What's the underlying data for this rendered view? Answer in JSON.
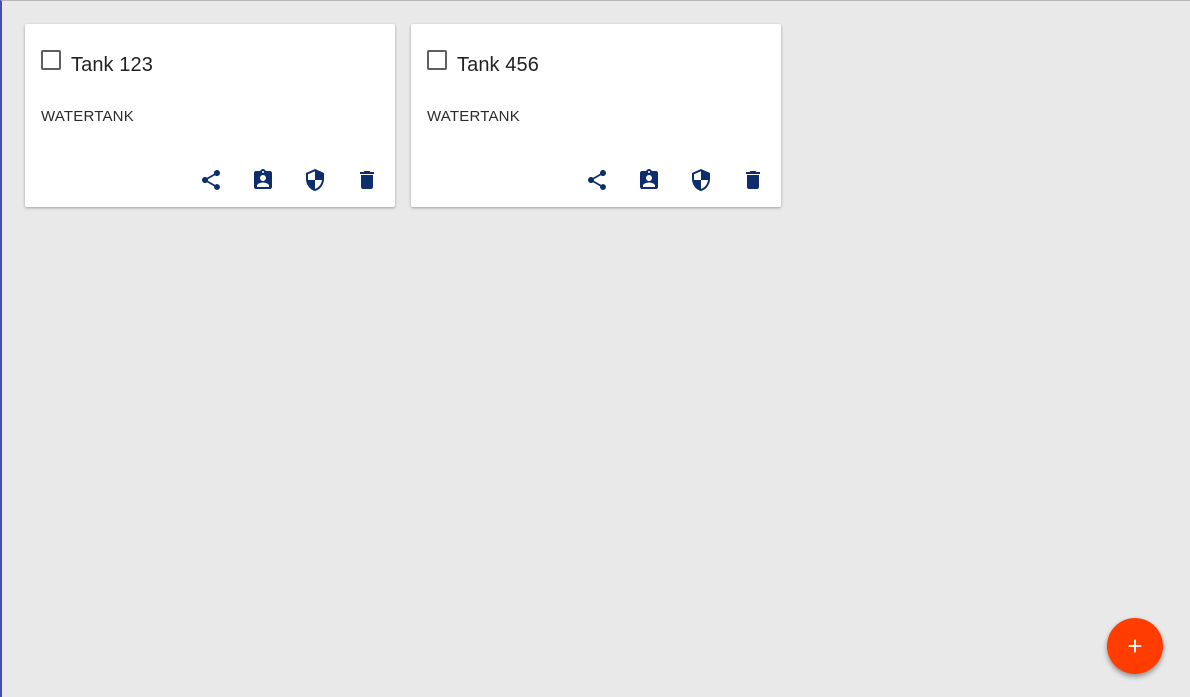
{
  "cards": [
    {
      "title": "Tank 123",
      "type": "WATERTANK",
      "checked": false,
      "actions": [
        "share-icon",
        "assignment-ind-icon",
        "shield-icon",
        "delete-icon"
      ]
    },
    {
      "title": "Tank 456",
      "type": "WATERTANK",
      "checked": false,
      "actions": [
        "share-icon",
        "assignment-ind-icon",
        "shield-icon",
        "delete-icon"
      ]
    }
  ],
  "fab": {
    "icon": "add-icon"
  },
  "colors": {
    "background": "#e9e9e9",
    "card": "#ffffff",
    "icon": "#0d2d6c",
    "fab": "#ff3d00",
    "left_border": "#3f51b5"
  }
}
